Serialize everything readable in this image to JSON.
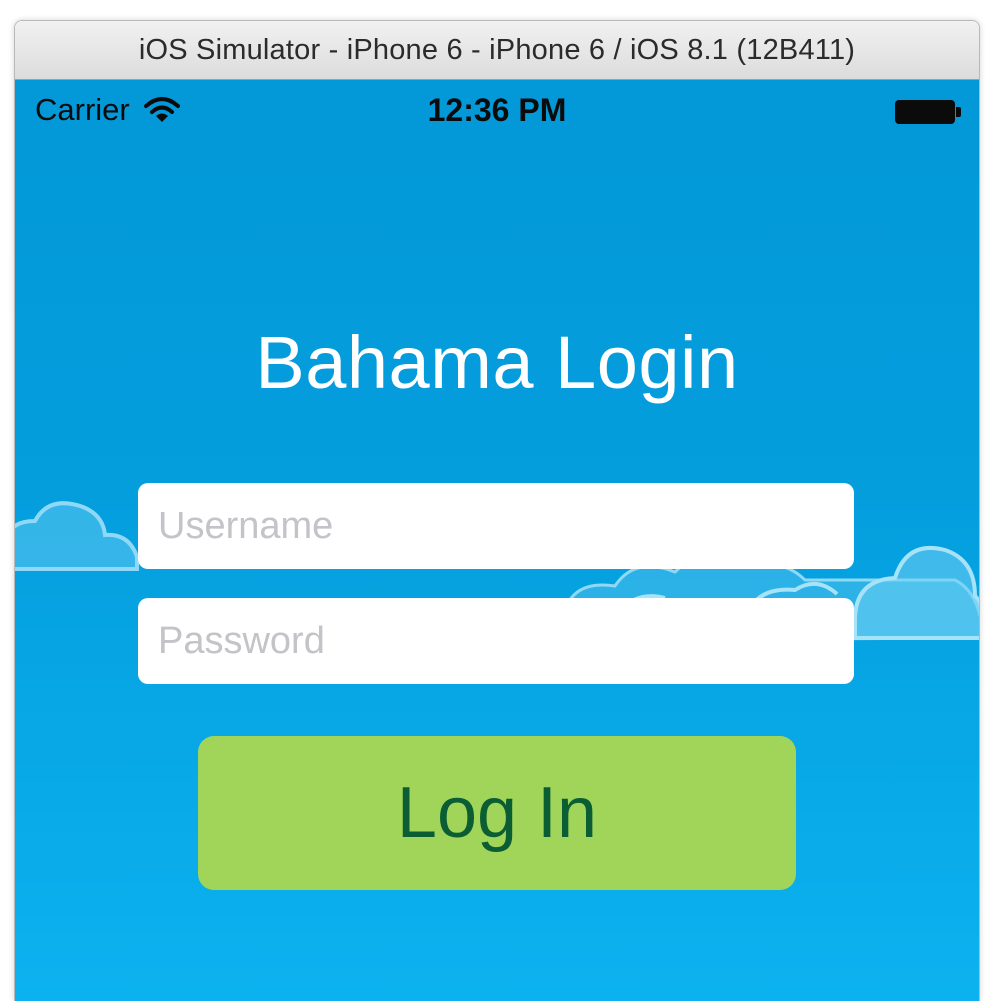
{
  "window": {
    "title": "iOS Simulator - iPhone 6 - iPhone 6 / iOS 8.1 (12B411)"
  },
  "status_bar": {
    "carrier": "Carrier",
    "time": "12:36 PM",
    "wifi_icon": "wifi-icon",
    "battery_icon": "battery-icon",
    "battery_level": 1.0
  },
  "login": {
    "heading": "Bahama Login",
    "username_placeholder": "Username",
    "username_value": "",
    "password_placeholder": "Password",
    "password_value": "",
    "button_label": "Log In"
  },
  "colors": {
    "sky_top": "#0398d8",
    "sky_bottom": "#0cb2ef",
    "button_bg": "#a0d559",
    "button_text": "#0b5e33",
    "field_bg": "#ffffff",
    "placeholder": "#c3c3c8"
  }
}
